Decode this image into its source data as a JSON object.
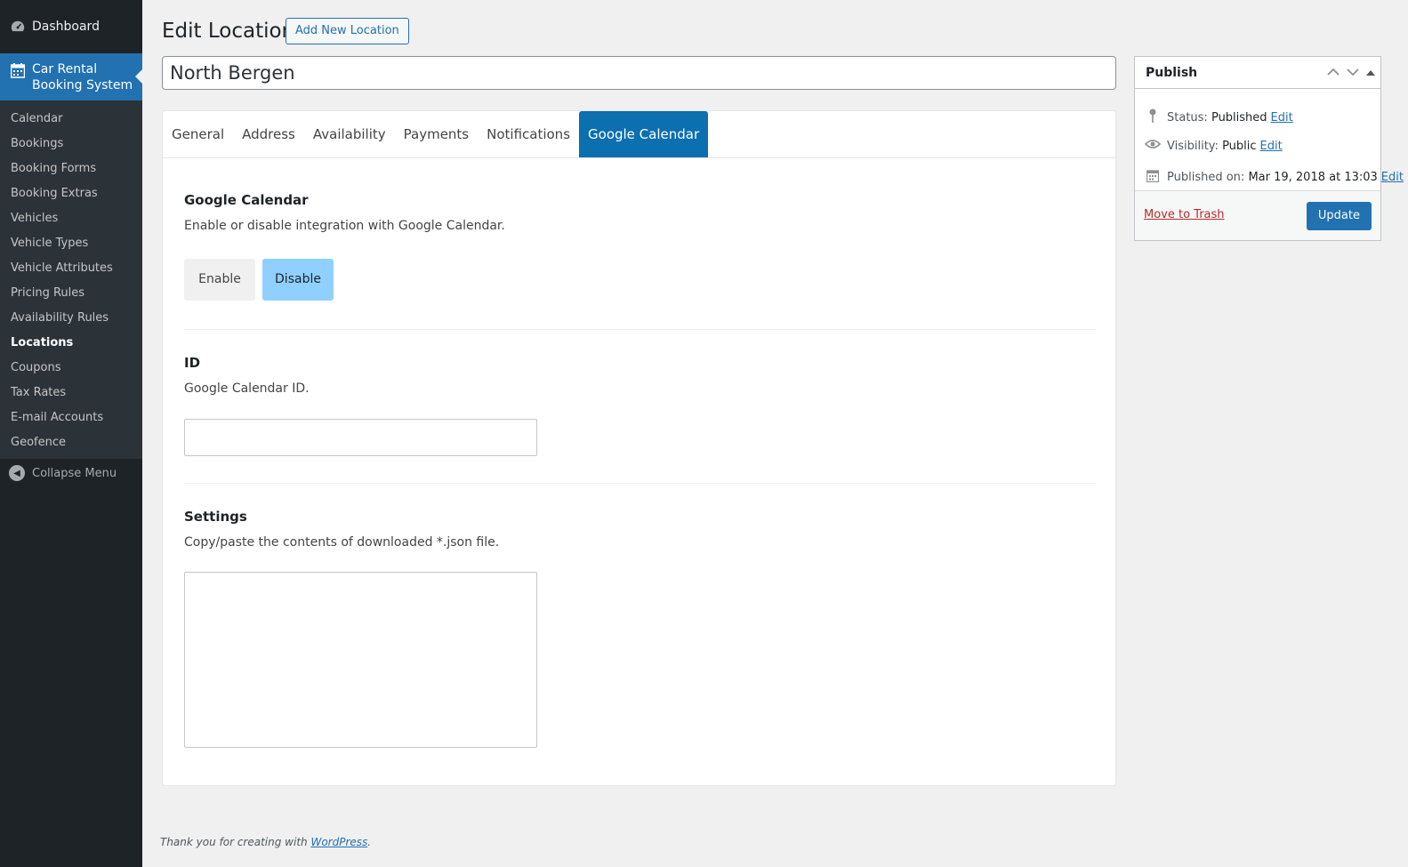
{
  "sidebar": {
    "dashboard_label": "Dashboard",
    "plugin_label_1": "Car Rental",
    "plugin_label_2": "Booking System",
    "items": [
      {
        "label": "Calendar"
      },
      {
        "label": "Bookings"
      },
      {
        "label": "Booking Forms"
      },
      {
        "label": "Booking Extras"
      },
      {
        "label": "Vehicles"
      },
      {
        "label": "Vehicle Types"
      },
      {
        "label": "Vehicle Attributes"
      },
      {
        "label": "Pricing Rules"
      },
      {
        "label": "Availability Rules"
      },
      {
        "label": "Locations"
      },
      {
        "label": "Coupons"
      },
      {
        "label": "Tax Rates"
      },
      {
        "label": "E-mail Accounts"
      },
      {
        "label": "Geofence"
      }
    ],
    "current_item": "Locations",
    "collapse_label": "Collapse Menu"
  },
  "header": {
    "title": "Edit Location",
    "add_new_label": "Add New Location"
  },
  "post_title": "North Bergen",
  "tabs": [
    {
      "label": "General"
    },
    {
      "label": "Address"
    },
    {
      "label": "Availability"
    },
    {
      "label": "Payments"
    },
    {
      "label": "Notifications"
    },
    {
      "label": "Google Calendar"
    }
  ],
  "active_tab": "Google Calendar",
  "google_calendar": {
    "title": "Google Calendar",
    "description": "Enable or disable integration with Google Calendar.",
    "enable_label": "Enable",
    "disable_label": "Disable",
    "selected": "Disable"
  },
  "id_section": {
    "title": "ID",
    "description": "Google Calendar ID.",
    "value": ""
  },
  "settings_section": {
    "title": "Settings",
    "description": "Copy/paste the contents of downloaded *.json file.",
    "value": ""
  },
  "publish": {
    "title": "Publish",
    "status_label": "Status:",
    "status_value": "Published",
    "visibility_label": "Visibility:",
    "visibility_value": "Public",
    "published_label": "Published on:",
    "published_value": "Mar 19, 2018 at 13:03",
    "edit_label": "Edit",
    "trash_label": "Move to Trash",
    "update_label": "Update"
  },
  "footer": {
    "text": "Thank you for creating with ",
    "link": "WordPress",
    "suffix": "."
  },
  "colors": {
    "accent": "#2271b1",
    "active_tab": "#0b6fb0",
    "disable_selected": "#8fd0ff",
    "sidebar_bg": "#1d2327"
  }
}
